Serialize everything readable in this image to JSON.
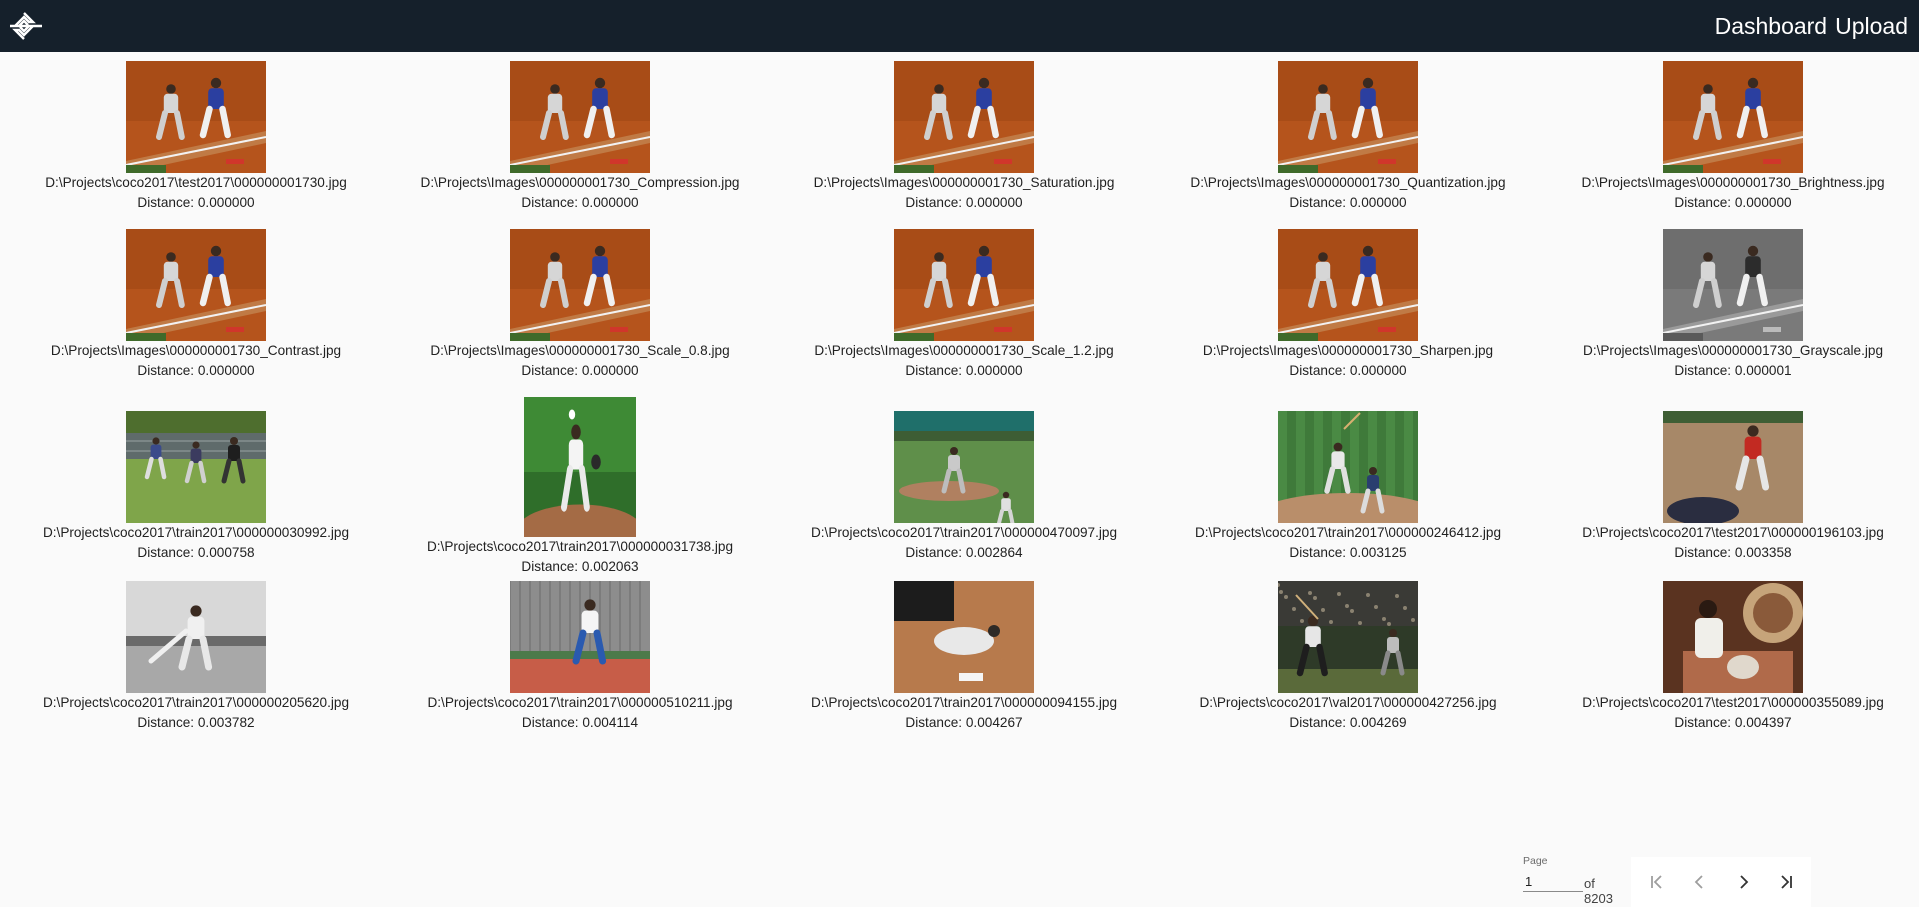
{
  "header": {
    "nav": [
      "Dashboard",
      "Upload"
    ]
  },
  "results": [
    {
      "path": "D:\\Projects\\coco2017\\test2017\\000000001730.jpg",
      "distance": "Distance: 0.000000",
      "scene": "batter-runner"
    },
    {
      "path": "D:\\Projects\\Images\\000000001730_Compression.jpg",
      "distance": "Distance: 0.000000",
      "scene": "batter-runner"
    },
    {
      "path": "D:\\Projects\\Images\\000000001730_Saturation.jpg",
      "distance": "Distance: 0.000000",
      "scene": "batter-runner"
    },
    {
      "path": "D:\\Projects\\Images\\000000001730_Quantization.jpg",
      "distance": "Distance: 0.000000",
      "scene": "batter-runner"
    },
    {
      "path": "D:\\Projects\\Images\\000000001730_Brightness.jpg",
      "distance": "Distance: 0.000000",
      "scene": "batter-runner"
    },
    {
      "path": "D:\\Projects\\Images\\000000001730_Contrast.jpg",
      "distance": "Distance: 0.000000",
      "scene": "batter-runner"
    },
    {
      "path": "D:\\Projects\\Images\\000000001730_Scale_0.8.jpg",
      "distance": "Distance: 0.000000",
      "scene": "batter-runner"
    },
    {
      "path": "D:\\Projects\\Images\\000000001730_Scale_1.2.jpg",
      "distance": "Distance: 0.000000",
      "scene": "batter-runner"
    },
    {
      "path": "D:\\Projects\\Images\\000000001730_Sharpen.jpg",
      "distance": "Distance: 0.000000",
      "scene": "batter-runner"
    },
    {
      "path": "D:\\Projects\\Images\\000000001730_Grayscale.jpg",
      "distance": "Distance: 0.000001",
      "scene": "batter-runner-gray"
    },
    {
      "path": "D:\\Projects\\coco2017\\train2017\\000000030992.jpg",
      "distance": "Distance: 0.000758",
      "scene": "field-dugout"
    },
    {
      "path": "D:\\Projects\\coco2017\\train2017\\000000031738.jpg",
      "distance": "Distance: 0.002063",
      "scene": "pitcher-portrait"
    },
    {
      "path": "D:\\Projects\\coco2017\\train2017\\000000470097.jpg",
      "distance": "Distance: 0.002864",
      "scene": "pitcher-field"
    },
    {
      "path": "D:\\Projects\\coco2017\\train2017\\000000246412.jpg",
      "distance": "Distance: 0.003125",
      "scene": "batter-catcher"
    },
    {
      "path": "D:\\Projects\\coco2017\\test2017\\000000196103.jpg",
      "distance": "Distance: 0.003358",
      "scene": "red-player"
    },
    {
      "path": "D:\\Projects\\coco2017\\train2017\\000000205620.jpg",
      "distance": "Distance: 0.003782",
      "scene": "vintage-pitcher"
    },
    {
      "path": "D:\\Projects\\coco2017\\train2017\\000000510211.jpg",
      "distance": "Distance: 0.004114",
      "scene": "tennis-player"
    },
    {
      "path": "D:\\Projects\\coco2017\\train2017\\000000094155.jpg",
      "distance": "Distance: 0.004267",
      "scene": "slide-home"
    },
    {
      "path": "D:\\Projects\\coco2017\\val2017\\000000427256.jpg",
      "distance": "Distance: 0.004269",
      "scene": "night-batter"
    },
    {
      "path": "D:\\Projects\\coco2017\\test2017\\000000355089.jpg",
      "distance": "Distance: 0.004397",
      "scene": "weaving-woman"
    }
  ],
  "pagination": {
    "page_label": "Page",
    "page_value": "1",
    "of_text": "of 8203",
    "first_icon": "first-page-icon",
    "prev_icon": "chevron-left-icon",
    "next_icon": "chevron-right-icon",
    "last_icon": "last-page-icon"
  },
  "colors": {
    "topbar": "#15202b",
    "background": "#fafafa"
  }
}
